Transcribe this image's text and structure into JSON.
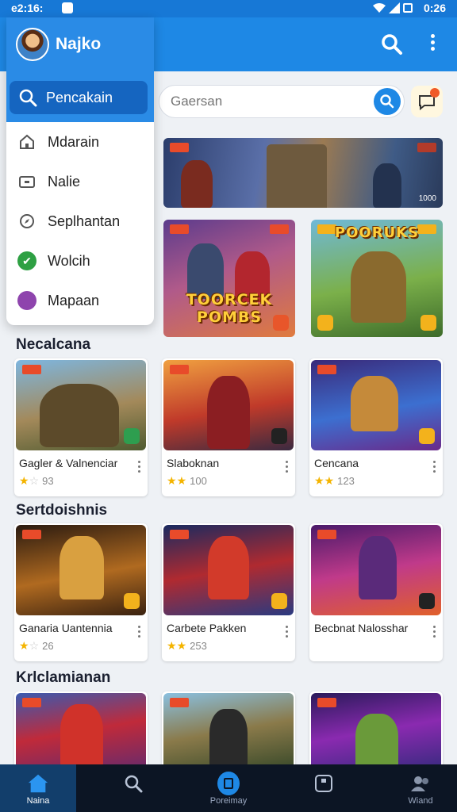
{
  "status_bar": {
    "time_left": "e2:16:",
    "time_right": "0:26"
  },
  "app_bar": {
    "user_name": "Najko"
  },
  "drawer": {
    "search_label": "Pencakain",
    "items": [
      {
        "label": "Mdarain",
        "icon": "home-icon"
      },
      {
        "label": "Nalie",
        "icon": "tv-icon"
      },
      {
        "label": "Seplhantan",
        "icon": "compass-icon"
      },
      {
        "label": "Wolcih",
        "icon": "check-circle-icon"
      },
      {
        "label": "Mapaan",
        "icon": "pie-icon"
      }
    ]
  },
  "search": {
    "placeholder": "Gaersan"
  },
  "featured": {
    "banner": {
      "count": "1000"
    },
    "tiles": [
      {
        "title": "TOORCEK POMBS"
      },
      {
        "title": "POORUKS"
      }
    ]
  },
  "sections": [
    {
      "title": "Necalcana",
      "cards": [
        {
          "title": "Gagler & Valnenciar",
          "stars": 1,
          "count": "93"
        },
        {
          "title": "Slaboknan",
          "stars": 2,
          "count": "100"
        },
        {
          "title": "Cencana",
          "stars": 2,
          "count": "123"
        }
      ]
    },
    {
      "title": "Sertdoishnis",
      "cards": [
        {
          "title": "Ganaria Uantennia",
          "stars": 1,
          "count": "26"
        },
        {
          "title": "Carbete Pakken",
          "stars": 2,
          "count": "253"
        },
        {
          "title": "Becbnat Nalosshar",
          "stars": 0,
          "count": ""
        }
      ]
    },
    {
      "title": "Krlclamianan",
      "cards": [
        {
          "title": ""
        },
        {
          "title": ""
        },
        {
          "title": ""
        }
      ]
    }
  ],
  "bottom_nav": [
    {
      "label": "Naina",
      "icon": "home-icon"
    },
    {
      "label": "",
      "icon": "search-icon"
    },
    {
      "label": "Poreimay",
      "icon": "library-icon"
    },
    {
      "label": "",
      "icon": "square-icon"
    },
    {
      "label": "Wiand",
      "icon": "people-icon"
    }
  ],
  "colors": {
    "primary": "#1e88e5",
    "nav_bg": "#0c1524",
    "star": "#f4b400"
  }
}
